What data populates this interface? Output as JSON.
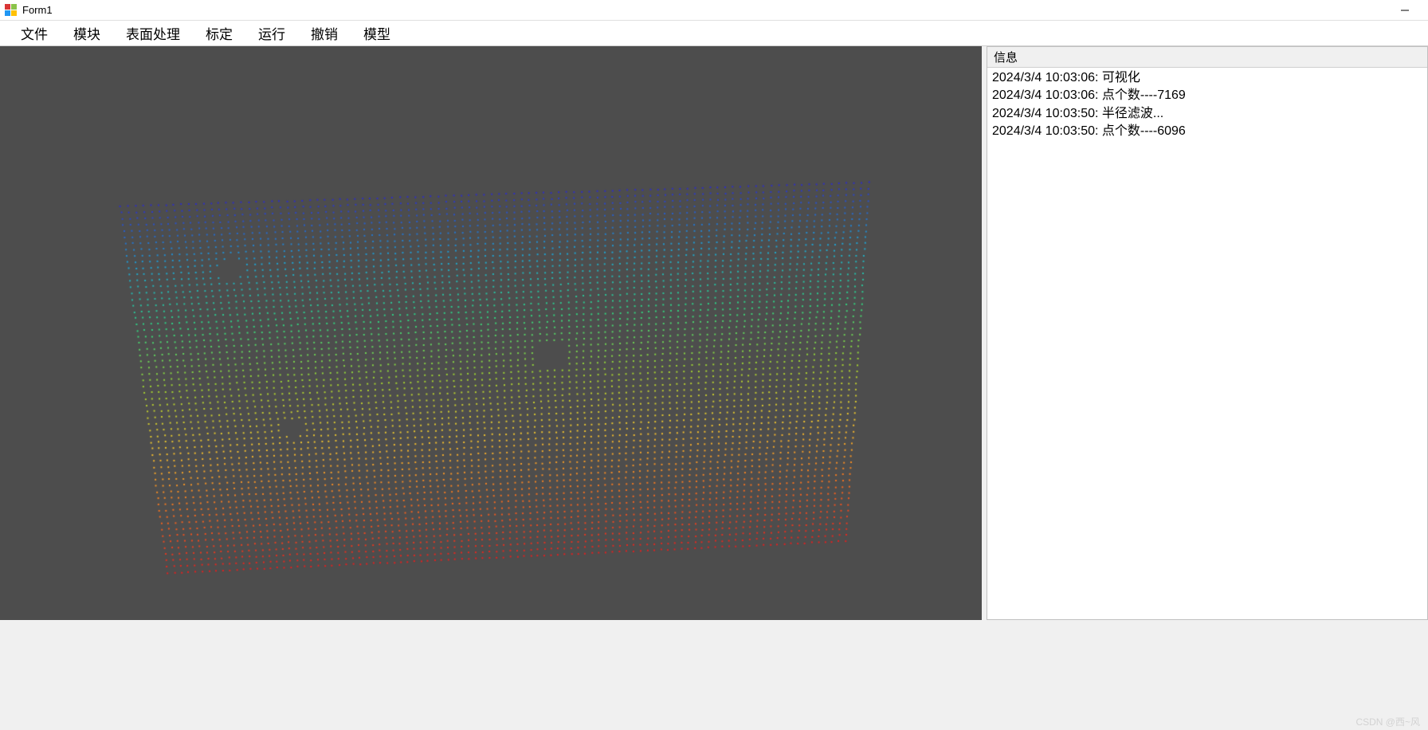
{
  "window": {
    "title": "Form1"
  },
  "menubar": {
    "items": [
      "文件",
      "模块",
      "表面处理",
      "标定",
      "运行",
      "撤销",
      "模型"
    ]
  },
  "side_panel": {
    "header": "信息",
    "log": [
      "2024/3/4 10:03:06: 可视化",
      "2024/3/4 10:03:06: 点个数----7169",
      "2024/3/4 10:03:50: 半径滤波...",
      "2024/3/4 10:03:50: 点个数----6096"
    ]
  },
  "viewport": {
    "background": "#4d4d4d",
    "point_cloud": {
      "approx_point_count": 6096,
      "color_gradient": [
        "#3030c0",
        "#20a0d0",
        "#30d080",
        "#a0d030",
        "#f0c030",
        "#f07020",
        "#e02020"
      ],
      "shape": "rotated-rectangular-surface"
    }
  },
  "watermark": "CSDN @西~风"
}
